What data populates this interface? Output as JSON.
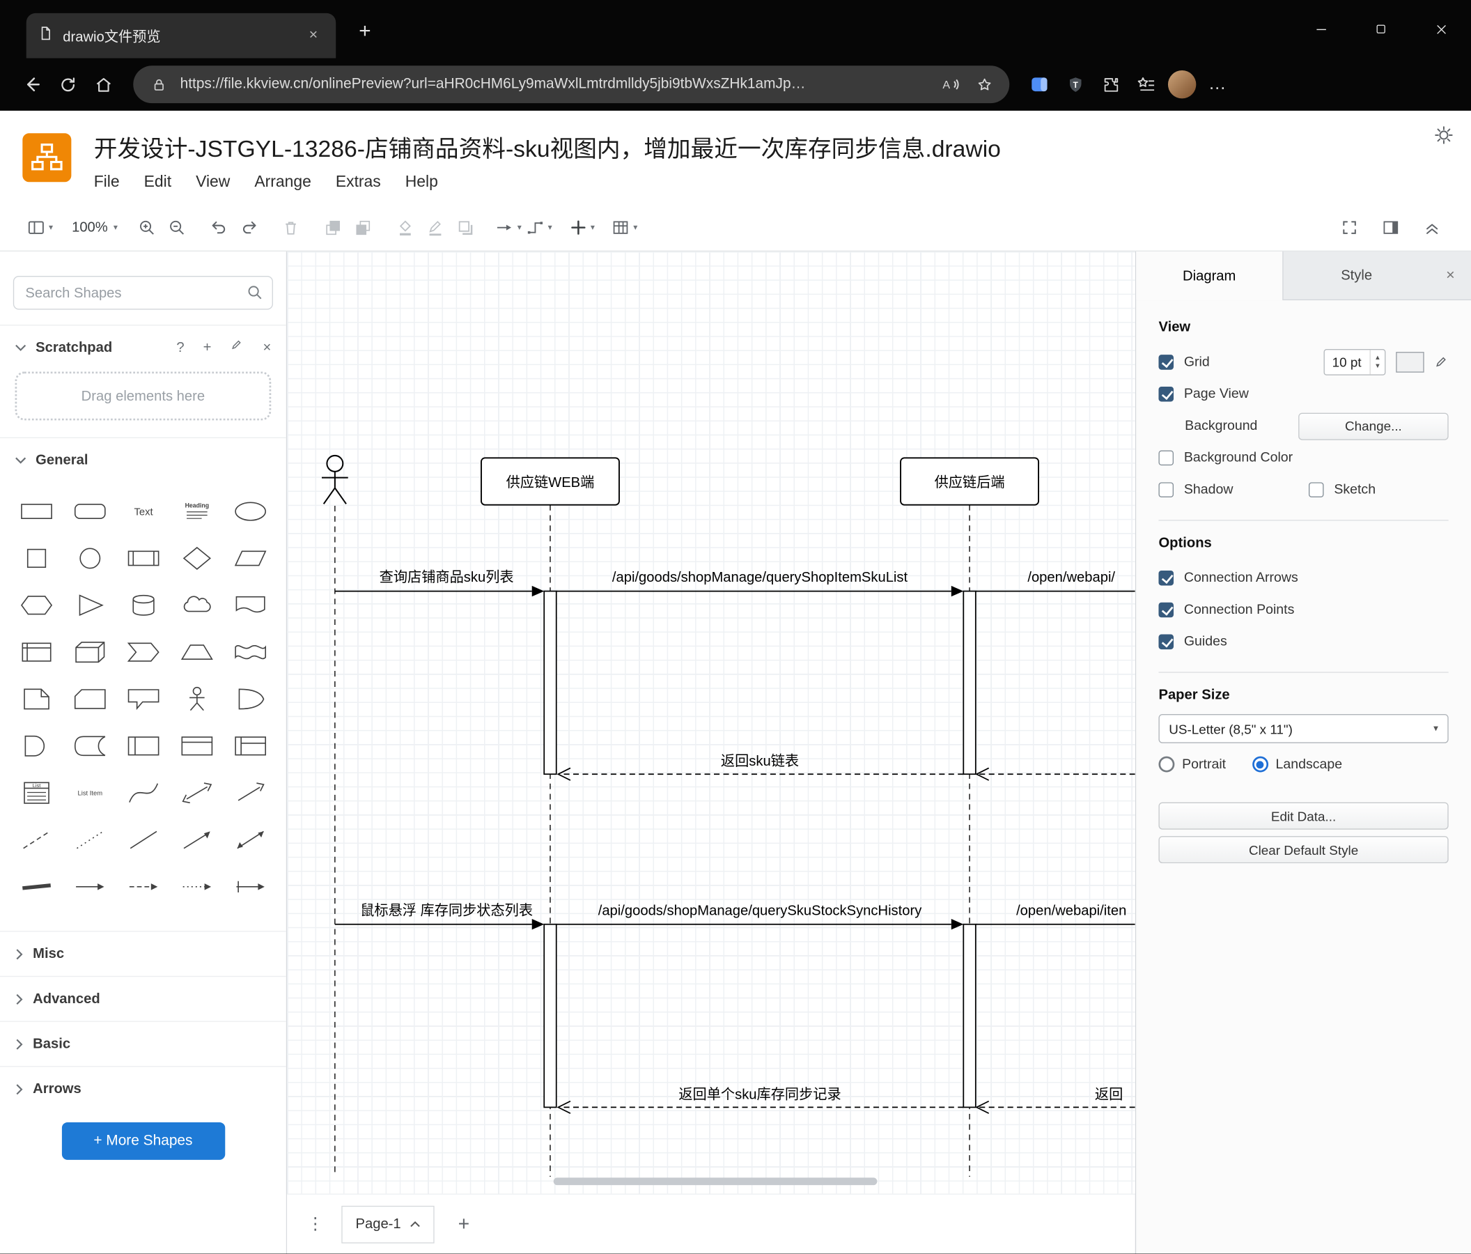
{
  "icons": {
    "caret_down": "▾",
    "help": "?",
    "plus": "+",
    "close": "×",
    "dots_vertical": "⋮",
    "overflow": "…"
  },
  "colors": {
    "logo_orange": "#F08705",
    "more_shapes_blue": "#1e7ad6",
    "checkbox_checked": "#375a7d",
    "radio_selected": "#1f6fd6",
    "edge_accent_blue": "#4e8df5"
  },
  "browser": {
    "tab_title": "drawio文件预览",
    "url": "https://file.kkview.cn/onlinePreview?url=aHR0cHM6Ly9maWxlLmtrdmlldy5jbi9tbWxsZHk1amJp…"
  },
  "header": {
    "title": "开发设计-JSTGYL-13286-店铺商品资料-sku视图内，增加最近一次库存同步信息.drawio",
    "menus": [
      "File",
      "Edit",
      "View",
      "Arrange",
      "Extras",
      "Help"
    ]
  },
  "toolbar": {
    "zoom_level": "100%"
  },
  "sidebar": {
    "search_placeholder": "Search Shapes",
    "scratchpad_title": "Scratchpad",
    "drag_hint": "Drag elements here",
    "sections": {
      "general": "General",
      "misc": "Misc",
      "advanced": "Advanced",
      "basic": "Basic",
      "arrows": "Arrows"
    },
    "more_shapes_label": "+ More Shapes",
    "icon_texts": {
      "text": "Text",
      "heading": "Heading",
      "list": "List",
      "list_item": "List Item"
    },
    "shapes": [
      "rectangle",
      "rounded-rectangle",
      "text",
      "textbox",
      "ellipse",
      "square",
      "circle",
      "process",
      "diamond",
      "parallelogram",
      "hexagon",
      "triangle",
      "cylinder",
      "cloud",
      "document",
      "internal-storage",
      "cube",
      "step",
      "trap",
      "tape",
      "note",
      "card",
      "callout",
      "actor",
      "or",
      "and",
      "data-storage",
      "container",
      "vertical-container",
      "horizontal-container",
      "list",
      "list-item",
      "curve",
      "bidirectional-arrow",
      "arrow",
      "dashed-line",
      "dotted-line",
      "line",
      "directional-connector",
      "bidirectional-connector",
      "link",
      "horizontal-arrow",
      "dashed-arrow",
      "dotted-arrow",
      "arrow-with-bar"
    ]
  },
  "diagram": {
    "participants": {
      "web": "供应链WEB端",
      "backend": "供应链后端"
    },
    "messages": [
      {
        "label": "查询店铺商品sku列表",
        "type": "solid",
        "from": "user",
        "to": "web"
      },
      {
        "label": "/api/goods/shopManage/queryShopItemSkuList",
        "type": "solid",
        "from": "web",
        "to": "backend"
      },
      {
        "label": "/open/webapi/",
        "type": "solid",
        "from": "backend",
        "to": "external",
        "truncated": true
      },
      {
        "label": "返回sku链表",
        "type": "dashed-return",
        "from": "backend",
        "to": "web"
      },
      {
        "label": "鼠标悬浮 库存同步状态列表",
        "type": "solid",
        "from": "user",
        "to": "web"
      },
      {
        "label": "/api/goods/shopManage/querySkuStockSyncHistory",
        "type": "solid",
        "from": "web",
        "to": "backend"
      },
      {
        "label": "/open/webapi/iten",
        "type": "solid",
        "from": "backend",
        "to": "external",
        "truncated": true
      },
      {
        "label": "返回单个sku库存同步记录",
        "type": "dashed-return",
        "from": "backend",
        "to": "web"
      },
      {
        "label": "返回",
        "type": "dashed-return",
        "from": "external",
        "to": "backend",
        "truncated": true
      }
    ]
  },
  "format_panel": {
    "tabs": [
      "Diagram",
      "Style"
    ],
    "view": {
      "heading": "View",
      "grid": {
        "label": "Grid",
        "checked": true,
        "size": "10 pt"
      },
      "page_view": {
        "label": "Page View",
        "checked": true
      },
      "background_label": "Background",
      "change_button": "Change...",
      "background_color": {
        "label": "Background Color",
        "checked": false
      },
      "shadow": {
        "label": "Shadow",
        "checked": false
      },
      "sketch": {
        "label": "Sketch",
        "checked": false
      }
    },
    "options": {
      "heading": "Options",
      "items": [
        {
          "label": "Connection Arrows",
          "checked": true
        },
        {
          "label": "Connection Points",
          "checked": true
        },
        {
          "label": "Guides",
          "checked": true
        }
      ]
    },
    "paper": {
      "heading": "Paper Size",
      "value": "US-Letter (8,5\" x 11\")",
      "portrait_label": "Portrait",
      "portrait_selected": false,
      "landscape_label": "Landscape",
      "landscape_selected": true
    },
    "edit_data_button": "Edit Data...",
    "clear_style_button": "Clear Default Style"
  },
  "footer": {
    "page_name": "Page-1"
  }
}
